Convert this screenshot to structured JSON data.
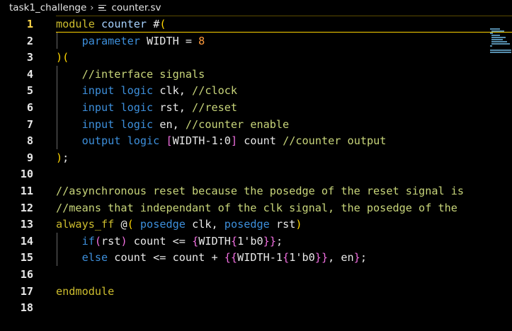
{
  "breadcrumb": {
    "folder": "task1_challenge",
    "separator": "›",
    "file": "counter.sv"
  },
  "editor": {
    "active_line": 1,
    "lines": [
      {
        "n": "1",
        "tokens": [
          [
            "kw",
            "module"
          ],
          [
            "op",
            " "
          ],
          [
            "id",
            "counter"
          ],
          [
            "op",
            " #"
          ],
          [
            "br2",
            "("
          ]
        ]
      },
      {
        "n": "2",
        "tokens": [
          [
            "op",
            "    "
          ],
          [
            "type",
            "parameter"
          ],
          [
            "op",
            " WIDTH = "
          ],
          [
            "num",
            "8"
          ]
        ]
      },
      {
        "n": "3",
        "tokens": [
          [
            "br2",
            ")"
          ],
          [
            "br2",
            "("
          ]
        ]
      },
      {
        "n": "4",
        "tokens": [
          [
            "op",
            "    "
          ],
          [
            "cmt",
            "//interface signals"
          ]
        ]
      },
      {
        "n": "5",
        "tokens": [
          [
            "op",
            "    "
          ],
          [
            "type",
            "input"
          ],
          [
            "op",
            " "
          ],
          [
            "type",
            "logic"
          ],
          [
            "op",
            " clk, "
          ],
          [
            "cmt",
            "//clock"
          ]
        ]
      },
      {
        "n": "6",
        "tokens": [
          [
            "op",
            "    "
          ],
          [
            "type",
            "input"
          ],
          [
            "op",
            " "
          ],
          [
            "type",
            "logic"
          ],
          [
            "op",
            " rst, "
          ],
          [
            "cmt",
            "//reset"
          ]
        ]
      },
      {
        "n": "7",
        "tokens": [
          [
            "op",
            "    "
          ],
          [
            "type",
            "input"
          ],
          [
            "op",
            " "
          ],
          [
            "type",
            "logic"
          ],
          [
            "op",
            " en, "
          ],
          [
            "cmt",
            "//counter enable"
          ]
        ]
      },
      {
        "n": "8",
        "tokens": [
          [
            "op",
            "    "
          ],
          [
            "type",
            "output"
          ],
          [
            "op",
            " "
          ],
          [
            "type",
            "logic"
          ],
          [
            "op",
            " "
          ],
          [
            "br",
            "["
          ],
          [
            "op",
            "WIDTH-1:0"
          ],
          [
            "br",
            "]"
          ],
          [
            "op",
            " count "
          ],
          [
            "cmt",
            "//counter output"
          ]
        ]
      },
      {
        "n": "9",
        "tokens": [
          [
            "br2",
            ")"
          ],
          [
            "op",
            ";"
          ]
        ]
      },
      {
        "n": "10",
        "tokens": []
      },
      {
        "n": "11",
        "tokens": [
          [
            "cmt",
            "//asynchronous reset because the posedge of the reset signal is"
          ]
        ]
      },
      {
        "n": "12",
        "tokens": [
          [
            "cmt",
            "//means that independant of the clk signal, the posedge of the"
          ]
        ]
      },
      {
        "n": "13",
        "tokens": [
          [
            "kw",
            "always_ff"
          ],
          [
            "op",
            " @"
          ],
          [
            "br2",
            "("
          ],
          [
            "op",
            " "
          ],
          [
            "type",
            "posedge"
          ],
          [
            "op",
            " clk, "
          ],
          [
            "type",
            "posedge"
          ],
          [
            "op",
            " rst"
          ],
          [
            "br2",
            ")"
          ]
        ]
      },
      {
        "n": "14",
        "tokens": [
          [
            "op",
            "    "
          ],
          [
            "type",
            "if"
          ],
          [
            "br",
            "("
          ],
          [
            "op",
            "rst"
          ],
          [
            "br",
            ")"
          ],
          [
            "op",
            " count <= "
          ],
          [
            "br",
            "{"
          ],
          [
            "op",
            "WIDTH"
          ],
          [
            "br",
            "{"
          ],
          [
            "op",
            "1'b0"
          ],
          [
            "br",
            "}}"
          ],
          [
            "op",
            ";"
          ]
        ]
      },
      {
        "n": "15",
        "tokens": [
          [
            "op",
            "    "
          ],
          [
            "type",
            "else"
          ],
          [
            "op",
            " count <= count + "
          ],
          [
            "br",
            "{{"
          ],
          [
            "op",
            "WIDTH-1"
          ],
          [
            "br",
            "{"
          ],
          [
            "op",
            "1'b0"
          ],
          [
            "br",
            "}}"
          ],
          [
            "op",
            ", en"
          ],
          [
            "br",
            "}"
          ],
          [
            "op",
            ";"
          ]
        ]
      },
      {
        "n": "16",
        "tokens": []
      },
      {
        "n": "17",
        "tokens": [
          [
            "kw",
            "endmodule"
          ]
        ]
      },
      {
        "n": "18",
        "tokens": []
      }
    ]
  },
  "colors": {
    "background": "#000000",
    "keyword": "#cdbd2e",
    "type": "#3d8fdb",
    "comment": "#c8d57a",
    "number": "#ff9a3c",
    "bracket": "#f16fe0",
    "bracket_outer": "#ffd600",
    "active_line_number": "#ffd84a"
  }
}
